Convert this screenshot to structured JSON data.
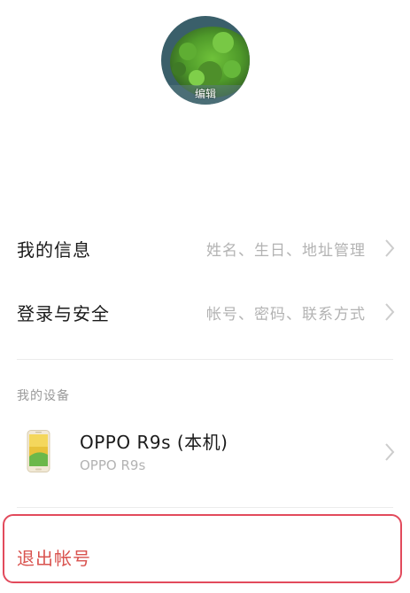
{
  "avatar": {
    "edit_label": "编辑"
  },
  "rows": [
    {
      "label": "我的信息",
      "hint": "姓名、生日、地址管理"
    },
    {
      "label": "登录与安全",
      "hint": "帐号、密码、联系方式"
    }
  ],
  "devices_section": {
    "title": "我的设备",
    "devices": [
      {
        "name": "OPPO R9s (本机)",
        "model": "OPPO R9s"
      }
    ]
  },
  "logout": {
    "label": "退出帐号"
  },
  "colors": {
    "logout_text": "#d9534f",
    "logout_highlight": "#e24a5c",
    "hint_text": "#b3b3b3"
  }
}
